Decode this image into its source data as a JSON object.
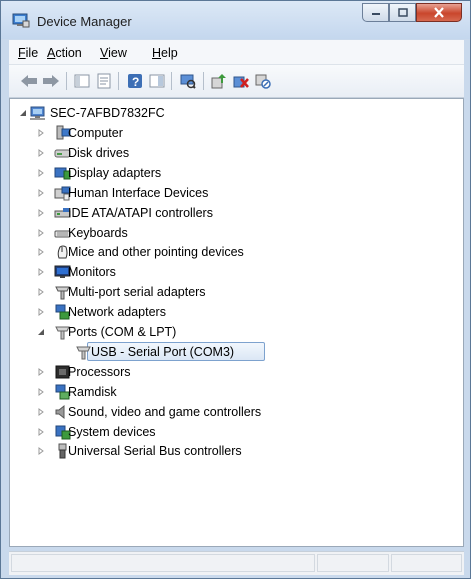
{
  "window": {
    "title": "Device Manager"
  },
  "menu": [
    {
      "key": "F",
      "rest": "ile",
      "name": "menu-file"
    },
    {
      "key": "A",
      "rest": "ction",
      "name": "menu-action"
    },
    {
      "key": "V",
      "rest": "iew",
      "name": "menu-view"
    },
    {
      "key": "H",
      "rest": "elp",
      "name": "menu-help"
    }
  ],
  "toolbar": {
    "icons": [
      "back-arrow-icon",
      "forward-arrow-icon",
      "show-hide-console-tree-icon",
      "properties-icon",
      "help-icon",
      "show-action-pane-icon",
      "scan-hardware-changes-icon",
      "update-driver-icon",
      "uninstall-device-icon",
      "disable-device-icon"
    ]
  },
  "tree": {
    "root": "SEC-7AFBD7832FC",
    "categories": [
      {
        "label": "Computer",
        "icon": "computer-icon"
      },
      {
        "label": "Disk drives",
        "icon": "disk-drive-icon"
      },
      {
        "label": "Display adapters",
        "icon": "display-adapter-icon"
      },
      {
        "label": "Human Interface Devices",
        "icon": "hid-icon"
      },
      {
        "label": "IDE ATA/ATAPI controllers",
        "icon": "ide-controller-icon"
      },
      {
        "label": "Keyboards",
        "icon": "keyboard-icon"
      },
      {
        "label": "Mice and other pointing devices",
        "icon": "mouse-icon"
      },
      {
        "label": "Monitors",
        "icon": "monitor-icon"
      },
      {
        "label": "Multi-port serial adapters",
        "icon": "serial-adapter-icon"
      },
      {
        "label": "Network adapters",
        "icon": "network-adapter-icon"
      },
      {
        "label": "Ports (COM & LPT)",
        "icon": "port-icon",
        "expanded": true
      },
      {
        "label": "USB - Serial Port (COM3)",
        "icon": "port-icon",
        "child": true,
        "selected": true
      },
      {
        "label": "Processors",
        "icon": "processor-icon"
      },
      {
        "label": "Ramdisk",
        "icon": "ramdisk-icon"
      },
      {
        "label": "Sound, video and game controllers",
        "icon": "sound-icon"
      },
      {
        "label": "System devices",
        "icon": "system-device-icon"
      },
      {
        "label": "Universal Serial Bus controllers",
        "icon": "usb-icon"
      }
    ]
  }
}
